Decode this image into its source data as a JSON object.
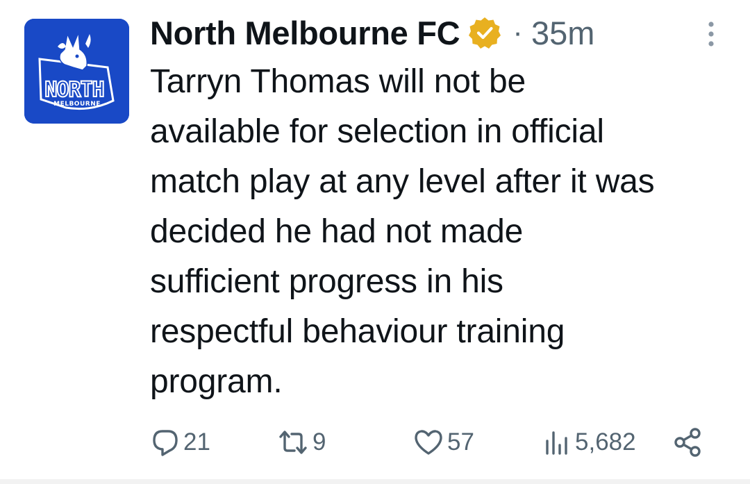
{
  "account": {
    "display_name": "North Melbourne FC",
    "separator": "·",
    "time_ago": "35m",
    "avatar_logo_text": "NORTH",
    "avatar_logo_subtext": "MELBOURNE"
  },
  "tweet": {
    "text": "Tarryn Thomas will not be\navailable for selection in official\nmatch play at any level after it was\ndecided he had not made\nsufficient progress in his\nrespectful behaviour training\nprogram."
  },
  "actions": {
    "replies": "21",
    "retweets": "9",
    "likes": "57",
    "views": "5,682"
  },
  "colors": {
    "brand_blue": "#1949c6",
    "verified_gold": "#e8b020",
    "text": "#0f1419",
    "secondary": "#536471"
  },
  "icons": [
    "more-options-icon",
    "verified-badge-icon",
    "reply-icon",
    "retweet-icon",
    "like-icon",
    "views-icon",
    "share-icon"
  ]
}
